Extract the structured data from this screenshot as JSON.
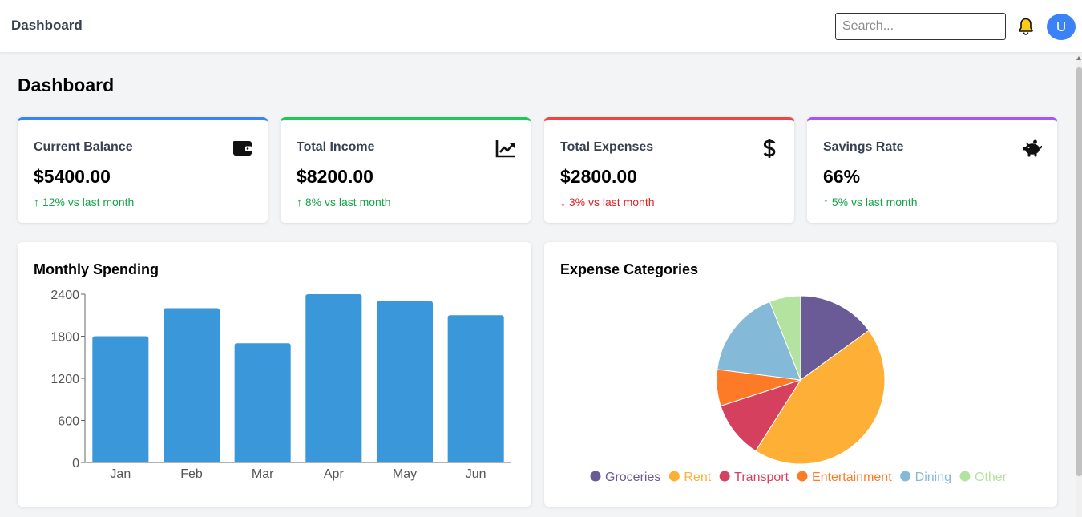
{
  "header": {
    "brand": "Dashboard",
    "search_placeholder": "Search...",
    "avatar_letter": "U"
  },
  "page": {
    "title": "Dashboard"
  },
  "cards": [
    {
      "label": "Current Balance",
      "value": "$5400.00",
      "change": "↑ 12% vs last month",
      "trend": "up",
      "icon": "wallet-icon",
      "accent": "#3b82f6"
    },
    {
      "label": "Total Income",
      "value": "$8200.00",
      "change": "↑ 8% vs last month",
      "trend": "up",
      "icon": "chart-line-icon",
      "accent": "#22c55e"
    },
    {
      "label": "Total Expenses",
      "value": "$2800.00",
      "change": "↓ 3% vs last month",
      "trend": "down",
      "icon": "dollar-icon",
      "accent": "#ef4444"
    },
    {
      "label": "Savings Rate",
      "value": "66%",
      "change": "↑ 5% vs last month",
      "trend": "up",
      "icon": "piggy-bank-icon",
      "accent": "#a855f7"
    }
  ],
  "panels": {
    "spending_title": "Monthly Spending",
    "categories_title": "Expense Categories"
  },
  "chart_data": [
    {
      "type": "bar",
      "title": "Monthly Spending",
      "categories": [
        "Jan",
        "Feb",
        "Mar",
        "Apr",
        "May",
        "Jun"
      ],
      "values": [
        1800,
        2200,
        1700,
        2400,
        2300,
        2100
      ],
      "ylim": [
        0,
        2400
      ],
      "yticks": [
        0,
        600,
        1200,
        1800,
        2400
      ],
      "color": "#3a97da",
      "grid": false
    },
    {
      "type": "pie",
      "title": "Expense Categories",
      "labels": [
        "Groceries",
        "Rent",
        "Transport",
        "Entertainment",
        "Dining",
        "Other"
      ],
      "values": [
        15,
        44,
        11,
        7,
        17,
        6
      ],
      "colors": [
        "#6a5a96",
        "#fdb035",
        "#d6405f",
        "#fd7b26",
        "#84b9d7",
        "#b3e39f"
      ],
      "legend": "bottom"
    }
  ]
}
